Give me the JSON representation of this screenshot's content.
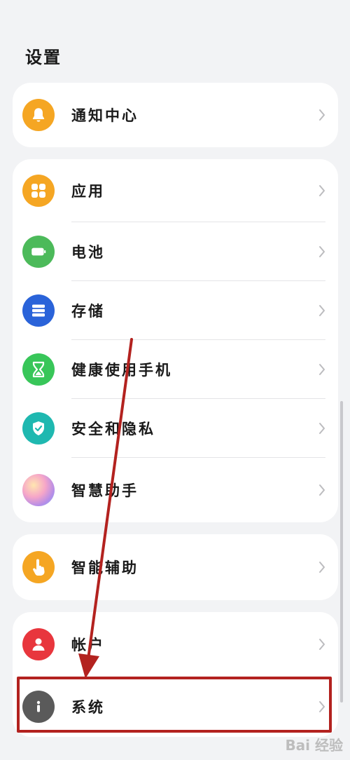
{
  "header": {
    "title": "设置"
  },
  "groups": [
    {
      "items": [
        {
          "label": "通知中心",
          "icon": "bell-icon",
          "color": "#f5a623"
        }
      ]
    },
    {
      "items": [
        {
          "label": "应用",
          "icon": "apps-grid-icon",
          "color": "#f5a623"
        },
        {
          "label": "电池",
          "icon": "battery-icon",
          "color": "#4cba5a"
        },
        {
          "label": "存储",
          "icon": "storage-icon",
          "color": "#2a63d9"
        },
        {
          "label": "健康使用手机",
          "icon": "hourglass-icon",
          "color": "#38c659"
        },
        {
          "label": "安全和隐私",
          "icon": "shield-check-icon",
          "color": "#1fb8b0"
        },
        {
          "label": "智慧助手",
          "icon": "assistant-orb-icon",
          "color": "#c98be6"
        }
      ]
    },
    {
      "items": [
        {
          "label": "智能辅助",
          "icon": "hand-tap-icon",
          "color": "#f5a623"
        }
      ]
    },
    {
      "items": [
        {
          "label": "帐户",
          "icon": "account-icon",
          "color": "#e8363d"
        },
        {
          "label": "系统",
          "icon": "info-icon",
          "color": "#5a5a5a"
        }
      ]
    }
  ],
  "annotation": {
    "color": "#b3221f",
    "target": "系统"
  },
  "watermark": "Bai 经验"
}
